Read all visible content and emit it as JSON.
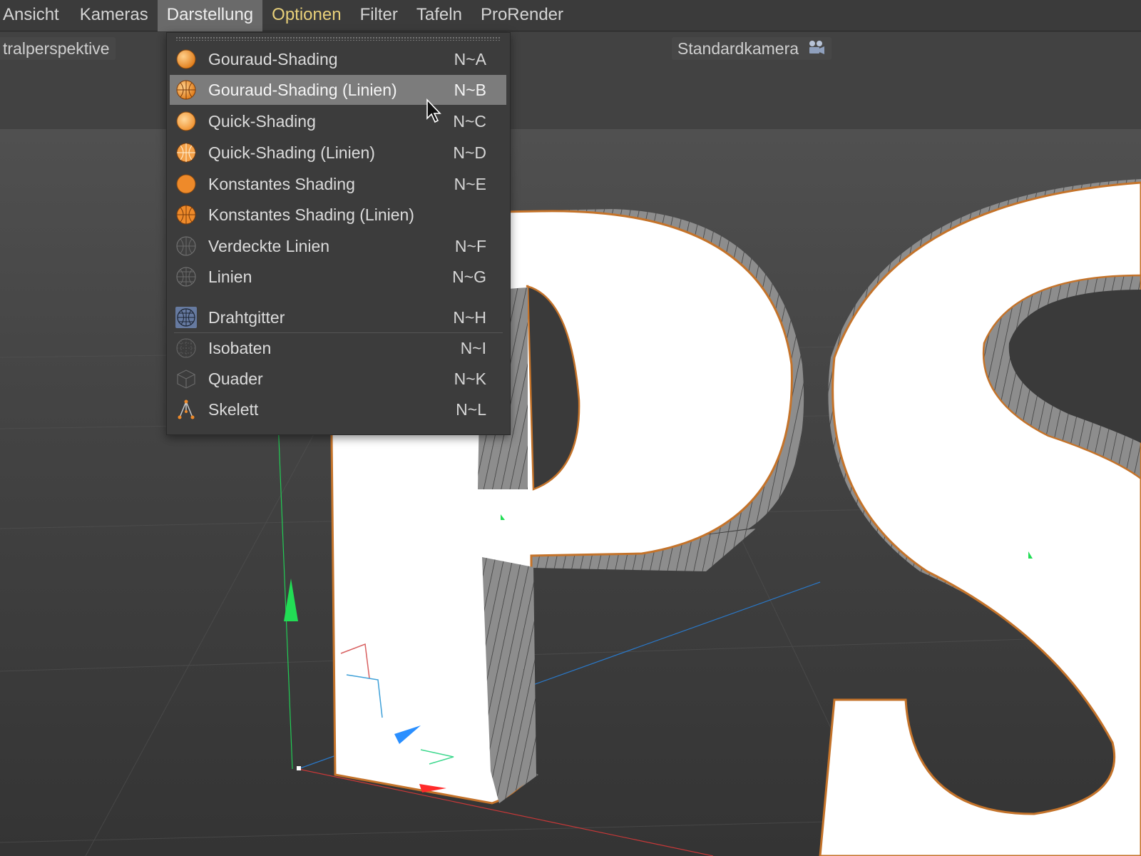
{
  "menubar": {
    "items": [
      {
        "label": "Ansicht"
      },
      {
        "label": "Kameras"
      },
      {
        "label": "Darstellung",
        "active": true
      },
      {
        "label": "Optionen",
        "highlighted": true
      },
      {
        "label": "Filter"
      },
      {
        "label": "Tafeln"
      },
      {
        "label": "ProRender"
      }
    ]
  },
  "viewport": {
    "view_label": "tralperspektive",
    "camera_label": "Standardkamera",
    "camera_icon": "camera-icon"
  },
  "dropdown": {
    "items": [
      {
        "label": "Gouraud-Shading",
        "shortcut": "N~A",
        "icon": "gouraud-shading-icon"
      },
      {
        "label": "Gouraud-Shading (Linien)",
        "shortcut": "N~B",
        "icon": "gouraud-shading-lines-icon",
        "hovered": true
      },
      {
        "label": "Quick-Shading",
        "shortcut": "N~C",
        "icon": "quick-shading-icon"
      },
      {
        "label": "Quick-Shading (Linien)",
        "shortcut": "N~D",
        "icon": "quick-shading-lines-icon"
      },
      {
        "label": "Konstantes Shading",
        "shortcut": "N~E",
        "icon": "constant-shading-icon"
      },
      {
        "label": "Konstantes Shading (Linien)",
        "shortcut": "",
        "icon": "constant-shading-lines-icon"
      },
      {
        "label": "Verdeckte Linien",
        "shortcut": "N~F",
        "icon": "hidden-lines-icon"
      },
      {
        "label": "Linien",
        "shortcut": "N~G",
        "icon": "lines-icon"
      },
      {
        "label": "Drahtgitter",
        "shortcut": "N~H",
        "icon": "wireframe-icon",
        "selected": true
      },
      {
        "label": "Isobaten",
        "shortcut": "N~I",
        "icon": "isoparms-icon"
      },
      {
        "label": "Quader",
        "shortcut": "N~K",
        "icon": "box-icon"
      },
      {
        "label": "Skelett",
        "shortcut": "N~L",
        "icon": "skeleton-icon"
      }
    ]
  },
  "colors": {
    "accent_orange": "#ee8a2a",
    "menu_hover": "#7c7c7c",
    "menu_selected_icon_bg": "#667aa0",
    "highlight_text": "#e8d07a",
    "axis_green": "#22dd55",
    "axis_blue": "#2a8fff",
    "axis_red": "#ff2a2a"
  }
}
